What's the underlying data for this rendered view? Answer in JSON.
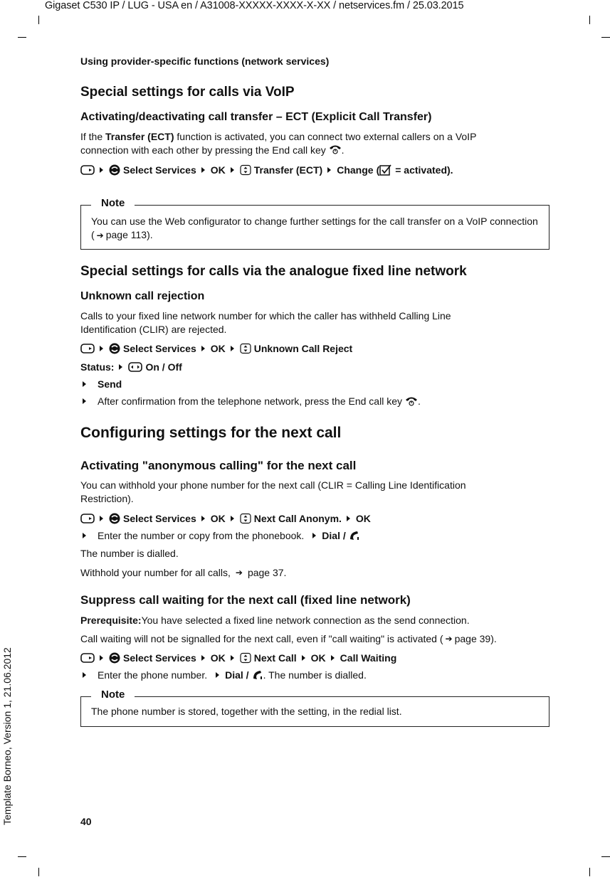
{
  "header": {
    "text": "Gigaset C530 IP / LUG - USA en / A31008-XXXXX-XXXX-X-XX / netservices.fm / 25.03.2015"
  },
  "running_head": "Using provider-specific functions (network services)",
  "side_text": "Template Borneo, Version 1, 21.06.2012",
  "page_number": "40",
  "sections": {
    "voip": {
      "title": "Special settings for calls via VoIP",
      "ect": {
        "title": "Activating/deactivating call transfer – ECT (Explicit Call Transfer)",
        "para_pre": "If the ",
        "para_bold1": "Transfer (ECT)",
        "para_mid": " function is activated, you can connect two external callers on a VoIP",
        "para_line2": "connection with each other by pressing the End call key",
        "para_end": ".",
        "path": {
          "select_services": "Select Services",
          "ok": "OK",
          "item": "Transfer (ECT)",
          "change": "Change",
          "change_paren_open": " (",
          "activated": " = activated)."
        }
      },
      "note": {
        "label": "Note",
        "text_pre": "You can use the Web configurator to change further settings for the call transfer on a VoIP connection (",
        "page_ref": "page 113",
        "text_post": ")."
      }
    },
    "analogue": {
      "title": "Special settings for calls via the analogue fixed line network",
      "reject": {
        "title": "Unknown call rejection",
        "para": "Calls to your fixed line network number for which the caller has withheld Calling Line Identification (CLIR) are rejected.",
        "path": {
          "select_services": "Select Services",
          "ok": "OK",
          "item": "Unknown Call Reject"
        },
        "status_label": "Status:",
        "status_value": "On / Off",
        "step_send": "Send",
        "step_confirm": "After confirmation from the telephone network, press the End call key",
        "step_confirm_end": "."
      }
    },
    "next_call": {
      "title": "Configuring settings for the next call",
      "anon": {
        "title": "Activating \"anonymous calling\" for the next call",
        "para": "You can withhold your phone number for the next call (CLIR = Calling Line Identification Restriction).",
        "path": {
          "select_services": "Select Services",
          "ok": "OK",
          "item": "Next Call Anonym.",
          "ok2": "OK"
        },
        "step_enter": "Enter the number or copy from the phonebook.",
        "step_dial": "Dial /",
        "dialled": "The number is dialled.",
        "withhold_pre": "Withhold your number for all calls,",
        "withhold_ref": "page 37."
      },
      "suppress": {
        "title": "Suppress call waiting for the next call (fixed line network)",
        "prereq_label": "Prerequisite:",
        "prereq_text": " You have selected a fixed line network connection as the send connection.",
        "para_pre": "Call waiting will not be signalled for the next call, even if \"call waiting\" is activated (",
        "para_ref": "page 39",
        "para_post": ").",
        "path": {
          "select_services": "Select Services",
          "ok": "OK",
          "item": "Next Call",
          "ok2": "OK",
          "call_waiting": "Call Waiting"
        },
        "step_enter": "Enter the phone number.",
        "step_dial": "Dial /",
        "step_dialled": ". The number is dialled."
      },
      "note": {
        "label": "Note",
        "text": "The phone number is stored, together with the setting, in the redial list."
      }
    }
  }
}
